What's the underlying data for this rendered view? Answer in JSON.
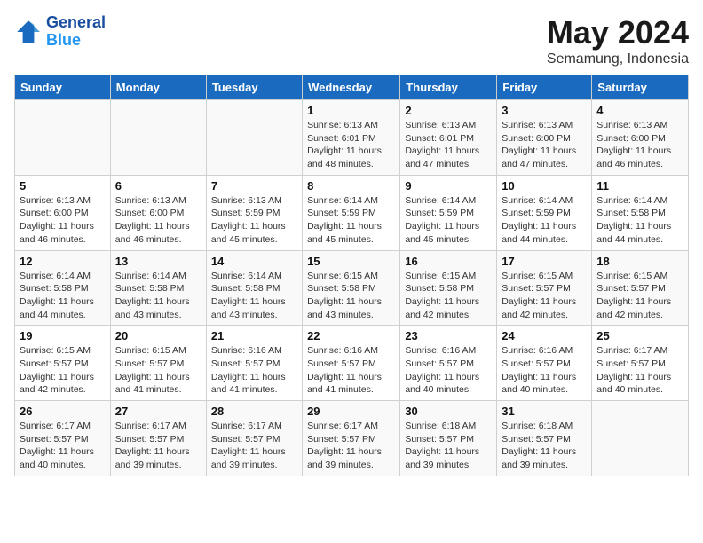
{
  "header": {
    "logo_line1": "General",
    "logo_line2": "Blue",
    "month_title": "May 2024",
    "location": "Semamung, Indonesia"
  },
  "weekdays": [
    "Sunday",
    "Monday",
    "Tuesday",
    "Wednesday",
    "Thursday",
    "Friday",
    "Saturday"
  ],
  "weeks": [
    [
      {
        "day": "",
        "info": ""
      },
      {
        "day": "",
        "info": ""
      },
      {
        "day": "",
        "info": ""
      },
      {
        "day": "1",
        "info": "Sunrise: 6:13 AM\nSunset: 6:01 PM\nDaylight: 11 hours\nand 48 minutes."
      },
      {
        "day": "2",
        "info": "Sunrise: 6:13 AM\nSunset: 6:01 PM\nDaylight: 11 hours\nand 47 minutes."
      },
      {
        "day": "3",
        "info": "Sunrise: 6:13 AM\nSunset: 6:00 PM\nDaylight: 11 hours\nand 47 minutes."
      },
      {
        "day": "4",
        "info": "Sunrise: 6:13 AM\nSunset: 6:00 PM\nDaylight: 11 hours\nand 46 minutes."
      }
    ],
    [
      {
        "day": "5",
        "info": "Sunrise: 6:13 AM\nSunset: 6:00 PM\nDaylight: 11 hours\nand 46 minutes."
      },
      {
        "day": "6",
        "info": "Sunrise: 6:13 AM\nSunset: 6:00 PM\nDaylight: 11 hours\nand 46 minutes."
      },
      {
        "day": "7",
        "info": "Sunrise: 6:13 AM\nSunset: 5:59 PM\nDaylight: 11 hours\nand 45 minutes."
      },
      {
        "day": "8",
        "info": "Sunrise: 6:14 AM\nSunset: 5:59 PM\nDaylight: 11 hours\nand 45 minutes."
      },
      {
        "day": "9",
        "info": "Sunrise: 6:14 AM\nSunset: 5:59 PM\nDaylight: 11 hours\nand 45 minutes."
      },
      {
        "day": "10",
        "info": "Sunrise: 6:14 AM\nSunset: 5:59 PM\nDaylight: 11 hours\nand 44 minutes."
      },
      {
        "day": "11",
        "info": "Sunrise: 6:14 AM\nSunset: 5:58 PM\nDaylight: 11 hours\nand 44 minutes."
      }
    ],
    [
      {
        "day": "12",
        "info": "Sunrise: 6:14 AM\nSunset: 5:58 PM\nDaylight: 11 hours\nand 44 minutes."
      },
      {
        "day": "13",
        "info": "Sunrise: 6:14 AM\nSunset: 5:58 PM\nDaylight: 11 hours\nand 43 minutes."
      },
      {
        "day": "14",
        "info": "Sunrise: 6:14 AM\nSunset: 5:58 PM\nDaylight: 11 hours\nand 43 minutes."
      },
      {
        "day": "15",
        "info": "Sunrise: 6:15 AM\nSunset: 5:58 PM\nDaylight: 11 hours\nand 43 minutes."
      },
      {
        "day": "16",
        "info": "Sunrise: 6:15 AM\nSunset: 5:58 PM\nDaylight: 11 hours\nand 42 minutes."
      },
      {
        "day": "17",
        "info": "Sunrise: 6:15 AM\nSunset: 5:57 PM\nDaylight: 11 hours\nand 42 minutes."
      },
      {
        "day": "18",
        "info": "Sunrise: 6:15 AM\nSunset: 5:57 PM\nDaylight: 11 hours\nand 42 minutes."
      }
    ],
    [
      {
        "day": "19",
        "info": "Sunrise: 6:15 AM\nSunset: 5:57 PM\nDaylight: 11 hours\nand 42 minutes."
      },
      {
        "day": "20",
        "info": "Sunrise: 6:15 AM\nSunset: 5:57 PM\nDaylight: 11 hours\nand 41 minutes."
      },
      {
        "day": "21",
        "info": "Sunrise: 6:16 AM\nSunset: 5:57 PM\nDaylight: 11 hours\nand 41 minutes."
      },
      {
        "day": "22",
        "info": "Sunrise: 6:16 AM\nSunset: 5:57 PM\nDaylight: 11 hours\nand 41 minutes."
      },
      {
        "day": "23",
        "info": "Sunrise: 6:16 AM\nSunset: 5:57 PM\nDaylight: 11 hours\nand 40 minutes."
      },
      {
        "day": "24",
        "info": "Sunrise: 6:16 AM\nSunset: 5:57 PM\nDaylight: 11 hours\nand 40 minutes."
      },
      {
        "day": "25",
        "info": "Sunrise: 6:17 AM\nSunset: 5:57 PM\nDaylight: 11 hours\nand 40 minutes."
      }
    ],
    [
      {
        "day": "26",
        "info": "Sunrise: 6:17 AM\nSunset: 5:57 PM\nDaylight: 11 hours\nand 40 minutes."
      },
      {
        "day": "27",
        "info": "Sunrise: 6:17 AM\nSunset: 5:57 PM\nDaylight: 11 hours\nand 39 minutes."
      },
      {
        "day": "28",
        "info": "Sunrise: 6:17 AM\nSunset: 5:57 PM\nDaylight: 11 hours\nand 39 minutes."
      },
      {
        "day": "29",
        "info": "Sunrise: 6:17 AM\nSunset: 5:57 PM\nDaylight: 11 hours\nand 39 minutes."
      },
      {
        "day": "30",
        "info": "Sunrise: 6:18 AM\nSunset: 5:57 PM\nDaylight: 11 hours\nand 39 minutes."
      },
      {
        "day": "31",
        "info": "Sunrise: 6:18 AM\nSunset: 5:57 PM\nDaylight: 11 hours\nand 39 minutes."
      },
      {
        "day": "",
        "info": ""
      }
    ]
  ]
}
